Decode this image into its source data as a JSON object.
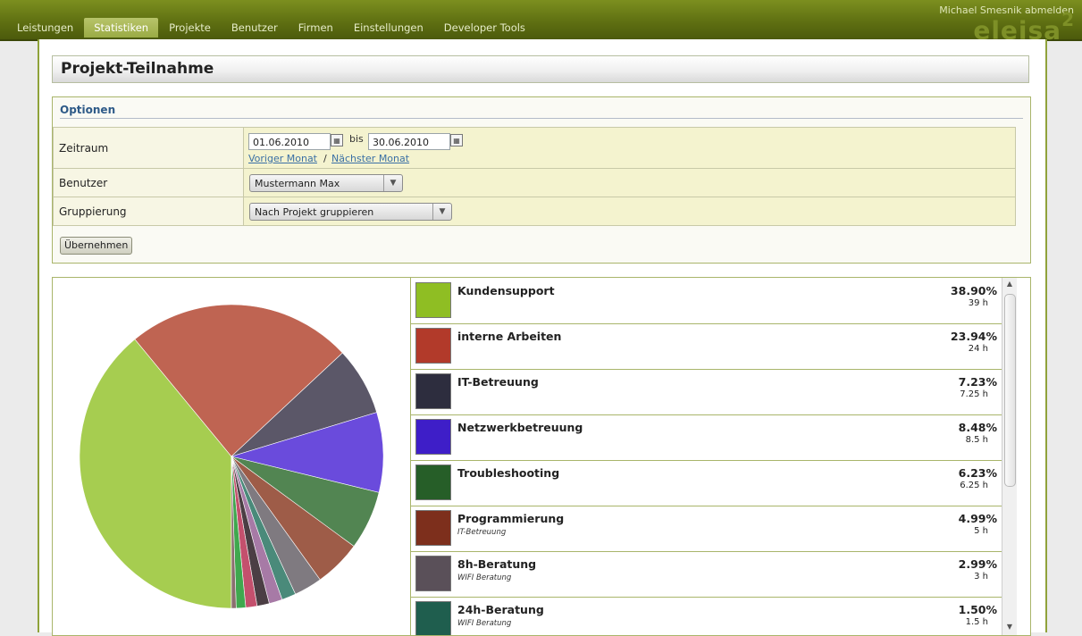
{
  "header": {
    "user_link": "Michael Smesnik abmelden",
    "brand": "eleisa",
    "brand_sup": "2",
    "nav": [
      "Leistungen",
      "Statistiken",
      "Projekte",
      "Benutzer",
      "Firmen",
      "Einstellungen",
      "Developer Tools"
    ],
    "active_nav": "Statistiken"
  },
  "page": {
    "title": "Projekt-Teilnahme"
  },
  "options": {
    "title": "Optionen",
    "zeitraum_label": "Zeitraum",
    "date_from": "01.06.2010",
    "bis_label": "bis",
    "date_to": "30.06.2010",
    "prev_month": "Voriger Monat",
    "separator": "/",
    "next_month": "Nächster Monat",
    "benutzer_label": "Benutzer",
    "benutzer_value": "Mustermann Max",
    "gruppierung_label": "Gruppierung",
    "gruppierung_value": "Nach Projekt gruppieren",
    "apply": "Übernehmen"
  },
  "icons": {
    "calendar": "calendar-icon",
    "dropdown": "chevron-down-icon",
    "scroll_up": "arrow-up-icon",
    "scroll_down": "arrow-down-icon"
  },
  "legend": [
    {
      "name": "Kundensupport",
      "sub": "",
      "percent": "38.90%",
      "hours": "39 h",
      "color": "#8fbe23"
    },
    {
      "name": "interne Arbeiten",
      "sub": "",
      "percent": "23.94%",
      "hours": "24 h",
      "color": "#b23a2a"
    },
    {
      "name": "IT-Betreuung",
      "sub": "",
      "percent": "7.23%",
      "hours": "7.25 h",
      "color": "#2d2d3e"
    },
    {
      "name": "Netzwerkbetreuung",
      "sub": "",
      "percent": "8.48%",
      "hours": "8.5 h",
      "color": "#3e1ec8"
    },
    {
      "name": "Troubleshooting",
      "sub": "",
      "percent": "6.23%",
      "hours": "6.25 h",
      "color": "#265e28"
    },
    {
      "name": "Programmierung",
      "sub": "IT-Betreuung",
      "percent": "4.99%",
      "hours": "5 h",
      "color": "#7d2f1c"
    },
    {
      "name": "8h-Beratung",
      "sub": "WIFI Beratung",
      "percent": "2.99%",
      "hours": "3 h",
      "color": "#5a5059"
    },
    {
      "name": "24h-Beratung",
      "sub": "WIFI Beratung",
      "percent": "1.50%",
      "hours": "1.5 h",
      "color": "#1f5e4e"
    }
  ],
  "chart_data": {
    "type": "pie",
    "slices": [
      {
        "label": "Kundensupport",
        "value": 38.9,
        "color": "#a6cd50"
      },
      {
        "label": "interne Arbeiten",
        "value": 23.94,
        "color": "#bf6452"
      },
      {
        "label": "IT-Betreuung",
        "value": 7.23,
        "color": "#5b5768"
      },
      {
        "label": "Netzwerkbetreuung",
        "value": 8.48,
        "color": "#6a4bdc"
      },
      {
        "label": "Troubleshooting",
        "value": 6.23,
        "color": "#528552"
      },
      {
        "label": "Programmierung",
        "value": 4.99,
        "color": "#9e5c48"
      },
      {
        "label": "8h-Beratung",
        "value": 2.99,
        "color": "#7f7a80"
      },
      {
        "label": "24h-Beratung",
        "value": 1.5,
        "color": "#4a8a7a"
      },
      {
        "label": "",
        "value": 1.4,
        "color": "#a77aa6"
      },
      {
        "label": "",
        "value": 1.3,
        "color": "#4b3e44"
      },
      {
        "label": "",
        "value": 1.2,
        "color": "#c4506d"
      },
      {
        "label": "",
        "value": 1.0,
        "color": "#3fa84e"
      },
      {
        "label": "",
        "value": 0.5,
        "color": "#8b6f6f"
      }
    ]
  }
}
